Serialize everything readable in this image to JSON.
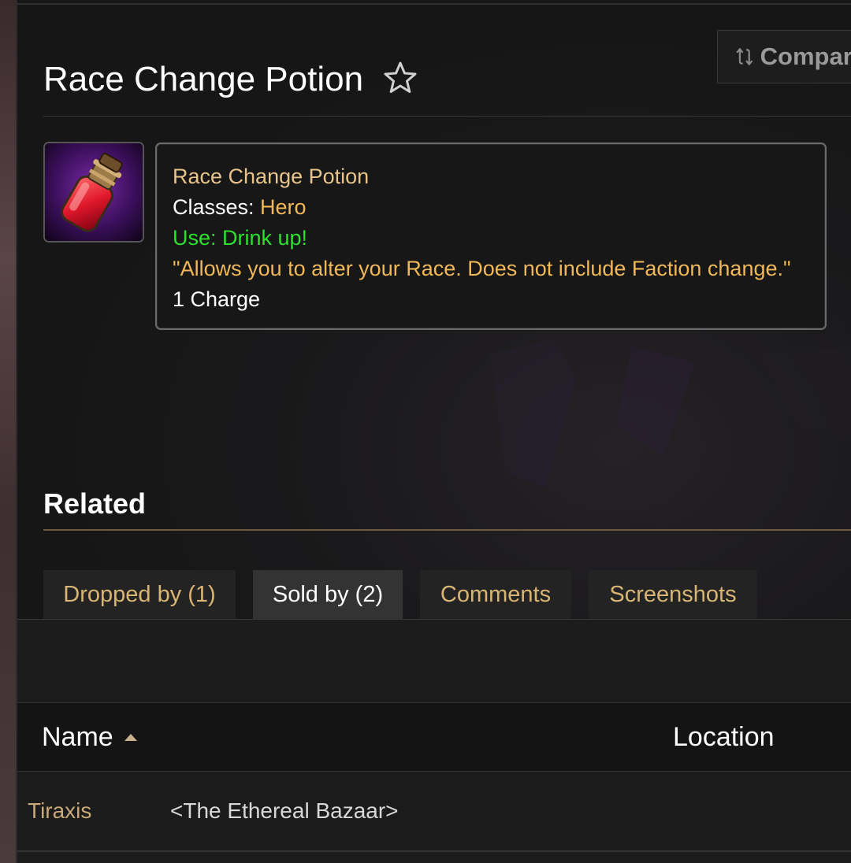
{
  "compare_button": {
    "label": "Compare",
    "icon": "compare-arrows-icon"
  },
  "item": {
    "title": "Race Change Potion",
    "favorite_icon": "star-outline-icon",
    "icon": "red-potion-icon",
    "tooltip": {
      "name": "Race Change Potion",
      "classes_label": "Classes:",
      "classes_value": "Hero",
      "use": "Use: Drink up!",
      "flavor": "\"Allows you to alter your Race. Does not include Faction change.\"",
      "charges": "1 Charge"
    }
  },
  "related": {
    "heading": "Related",
    "tabs": [
      {
        "label": "Dropped by (1)",
        "active": false
      },
      {
        "label": "Sold by (2)",
        "active": true
      },
      {
        "label": "Comments",
        "active": false
      },
      {
        "label": "Screenshots",
        "active": false
      }
    ]
  },
  "table": {
    "columns": {
      "name": "Name",
      "location": "Location"
    },
    "sort_icon": "sort-ascending-icon",
    "rows": [
      {
        "name": "Tiraxis",
        "subtitle": "<The Ethereal Bazaar>"
      }
    ]
  },
  "colors": {
    "quality_name": "#e8c48a",
    "class_gold": "#f0b858",
    "use_green": "#2ee02e",
    "link_tan": "#c9a877",
    "tab_text": "#d9b574"
  }
}
